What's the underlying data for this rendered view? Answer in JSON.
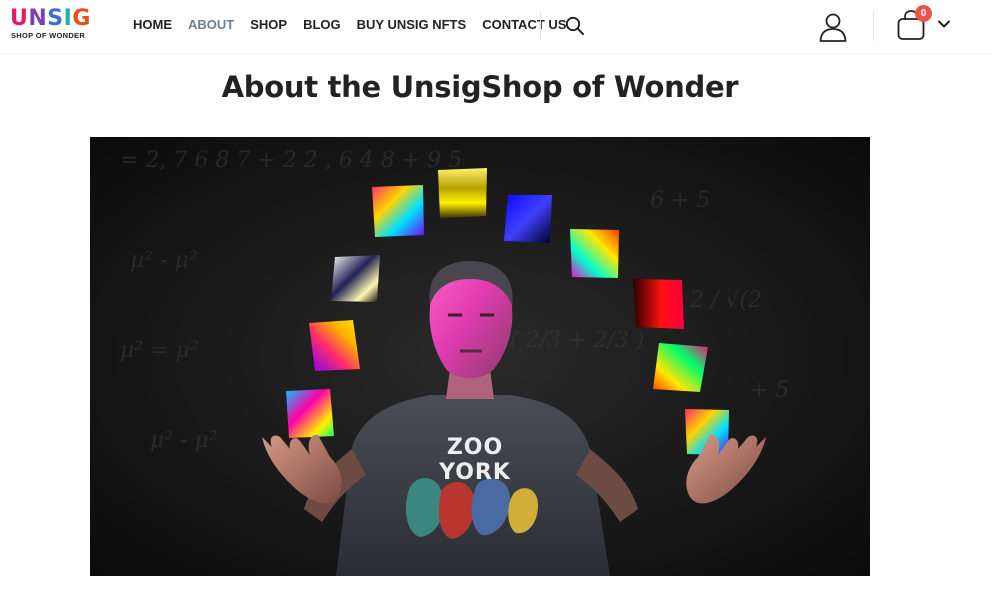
{
  "header": {
    "logo": {
      "word": "UNSIG",
      "tagline": "SHOP OF WONDER"
    },
    "nav": [
      {
        "label": "HOME",
        "active": false
      },
      {
        "label": "ABOUT",
        "active": true
      },
      {
        "label": "SHOP",
        "active": false
      },
      {
        "label": "BLOG",
        "active": false
      },
      {
        "label": "BUY UNSIG NFTS",
        "active": false
      },
      {
        "label": "CONTACT US",
        "active": false
      }
    ],
    "icons": {
      "search": "search-icon",
      "user": "user-icon",
      "cart": "shopping-bag-icon",
      "dropdown": "chevron-down-icon"
    },
    "cart_count": "0"
  },
  "main": {
    "title": "About the UnsigShop of Wonder",
    "hero": {
      "shirt_text": "ZOO YORK"
    }
  },
  "colors": {
    "active_nav": "#6d7f95",
    "badge": "#ef5350",
    "text": "#222222",
    "hero_bg": "#121212"
  }
}
